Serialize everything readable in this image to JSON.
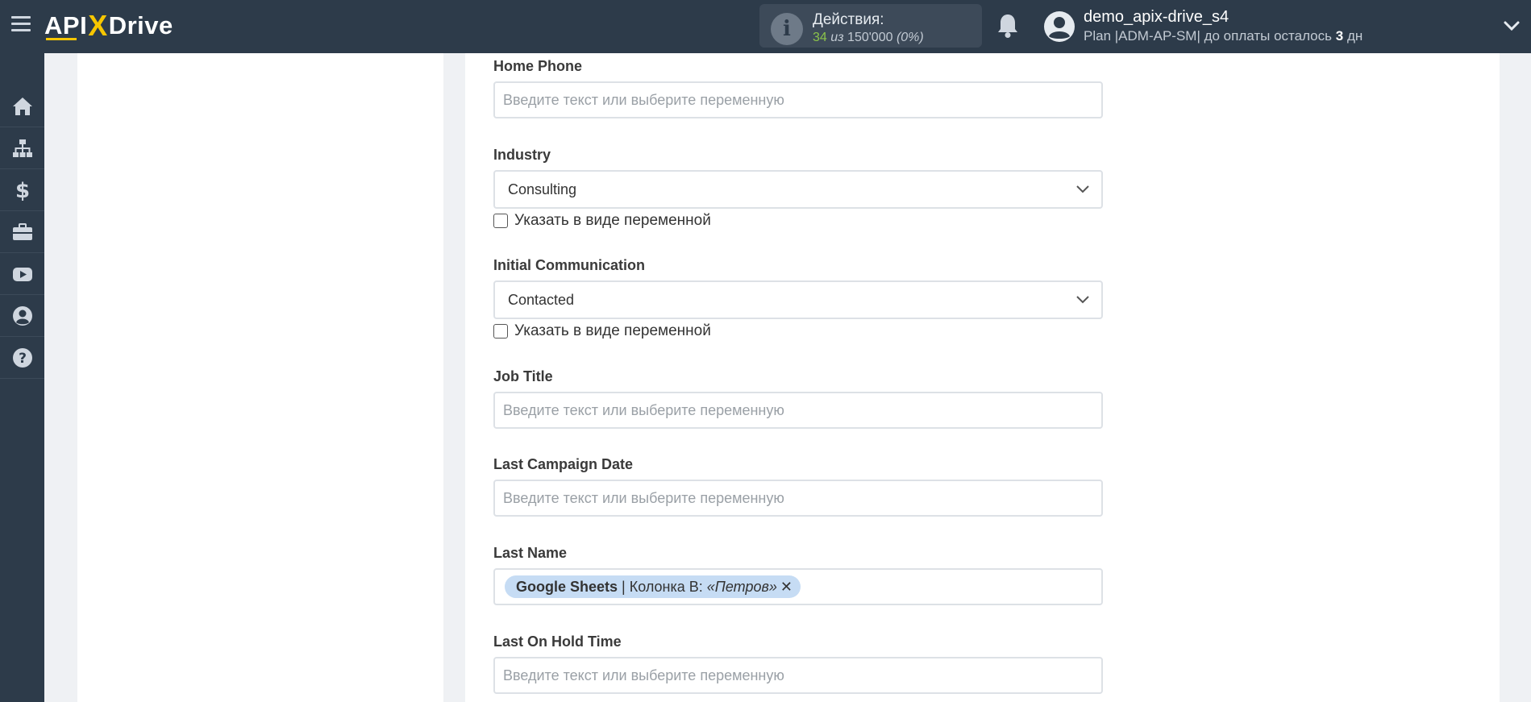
{
  "header": {
    "logo_left": "API",
    "logo_x": "X",
    "logo_right": "Drive",
    "actions_label": "Действия:",
    "actions_used": "34",
    "actions_sep": "из",
    "actions_total": "150'000",
    "actions_pct": "(0%)",
    "user_name": "demo_apix-drive_s4",
    "plan_prefix": "Plan |ADM-AP-SM| до оплаты осталось",
    "plan_days": "3",
    "plan_suffix": "дн"
  },
  "sidebar": {
    "items": [
      "home-icon",
      "sitemap-icon",
      "dollar-icon",
      "briefcase-icon",
      "youtube-icon",
      "user-circle-icon",
      "help-icon"
    ]
  },
  "form": {
    "fields": [
      {
        "label": "Home Phone",
        "type": "input",
        "placeholder": "Введите текст или выберите переменную"
      },
      {
        "label": "Industry",
        "type": "select",
        "value": "Consulting",
        "checkbox": "Указать в виде переменной"
      },
      {
        "label": "Initial Communication",
        "type": "select",
        "value": "Contacted",
        "checkbox": "Указать в виде переменной"
      },
      {
        "label": "Job Title",
        "type": "input",
        "placeholder": "Введите текст или выберите переменную"
      },
      {
        "label": "Last Campaign Date",
        "type": "input",
        "placeholder": "Введите текст или выберите переменную"
      },
      {
        "label": "Last Name",
        "type": "tag",
        "tag": {
          "source": "Google Sheets",
          "column": "| Колонка B:",
          "value": "«Петров»",
          "remove": "✕"
        }
      },
      {
        "label": "Last On Hold Time",
        "type": "input",
        "placeholder": "Введите текст или выберите переменную"
      }
    ]
  },
  "colors": {
    "topbar": "#2d3b4a",
    "accent": "#f7c600",
    "used_count": "#8bc34a",
    "tag_bg": "#c6dcf4"
  }
}
